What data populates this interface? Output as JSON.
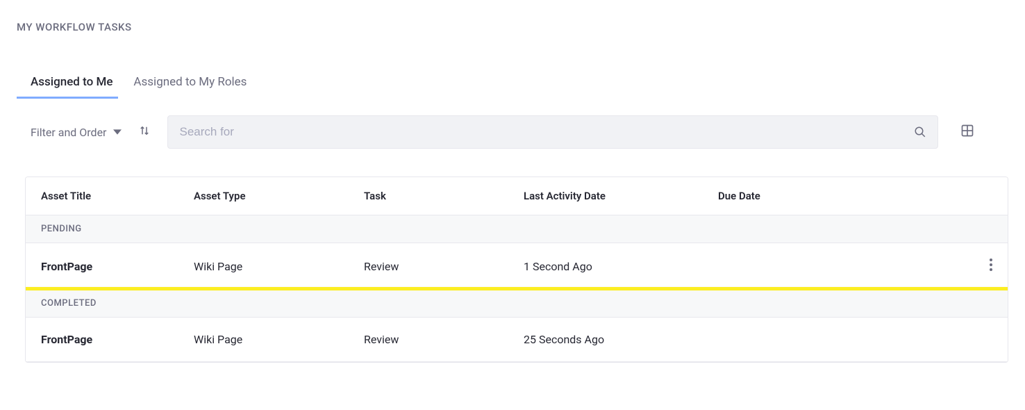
{
  "page_title": "MY WORKFLOW TASKS",
  "tabs": {
    "assigned_to_me": "Assigned to Me",
    "assigned_to_roles": "Assigned to My Roles"
  },
  "toolbar": {
    "filter_label": "Filter and Order",
    "search_placeholder": "Search for"
  },
  "table": {
    "columns": {
      "asset_title": "Asset Title",
      "asset_type": "Asset Type",
      "task": "Task",
      "last_activity": "Last Activity Date",
      "due_date": "Due Date"
    },
    "groups": {
      "pending": "PENDING",
      "completed": "COMPLETED"
    },
    "rows": {
      "pending": [
        {
          "asset_title": "FrontPage",
          "asset_type": "Wiki Page",
          "task": "Review",
          "last_activity": "1 Second Ago",
          "due_date": ""
        }
      ],
      "completed": [
        {
          "asset_title": "FrontPage",
          "asset_type": "Wiki Page",
          "task": "Review",
          "last_activity": "25 Seconds Ago",
          "due_date": ""
        }
      ]
    }
  }
}
